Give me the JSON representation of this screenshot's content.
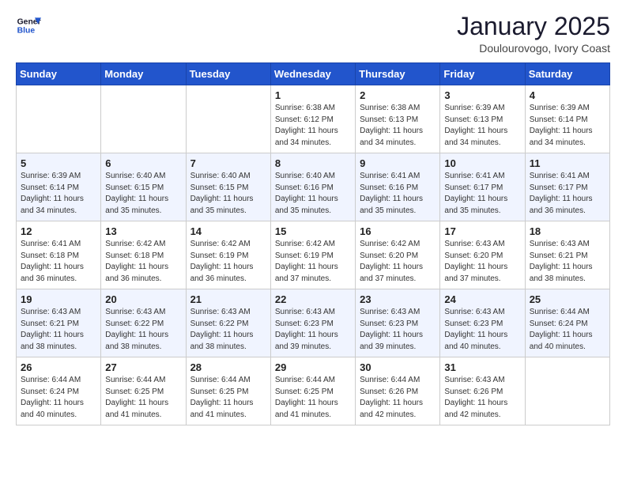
{
  "logo": {
    "line1": "General",
    "line2": "Blue"
  },
  "title": "January 2025",
  "location": "Doulourovogo, Ivory Coast",
  "weekdays": [
    "Sunday",
    "Monday",
    "Tuesday",
    "Wednesday",
    "Thursday",
    "Friday",
    "Saturday"
  ],
  "weeks": [
    [
      {
        "day": "",
        "info": ""
      },
      {
        "day": "",
        "info": ""
      },
      {
        "day": "",
        "info": ""
      },
      {
        "day": "1",
        "info": "Sunrise: 6:38 AM\nSunset: 6:12 PM\nDaylight: 11 hours\nand 34 minutes."
      },
      {
        "day": "2",
        "info": "Sunrise: 6:38 AM\nSunset: 6:13 PM\nDaylight: 11 hours\nand 34 minutes."
      },
      {
        "day": "3",
        "info": "Sunrise: 6:39 AM\nSunset: 6:13 PM\nDaylight: 11 hours\nand 34 minutes."
      },
      {
        "day": "4",
        "info": "Sunrise: 6:39 AM\nSunset: 6:14 PM\nDaylight: 11 hours\nand 34 minutes."
      }
    ],
    [
      {
        "day": "5",
        "info": "Sunrise: 6:39 AM\nSunset: 6:14 PM\nDaylight: 11 hours\nand 34 minutes."
      },
      {
        "day": "6",
        "info": "Sunrise: 6:40 AM\nSunset: 6:15 PM\nDaylight: 11 hours\nand 35 minutes."
      },
      {
        "day": "7",
        "info": "Sunrise: 6:40 AM\nSunset: 6:15 PM\nDaylight: 11 hours\nand 35 minutes."
      },
      {
        "day": "8",
        "info": "Sunrise: 6:40 AM\nSunset: 6:16 PM\nDaylight: 11 hours\nand 35 minutes."
      },
      {
        "day": "9",
        "info": "Sunrise: 6:41 AM\nSunset: 6:16 PM\nDaylight: 11 hours\nand 35 minutes."
      },
      {
        "day": "10",
        "info": "Sunrise: 6:41 AM\nSunset: 6:17 PM\nDaylight: 11 hours\nand 35 minutes."
      },
      {
        "day": "11",
        "info": "Sunrise: 6:41 AM\nSunset: 6:17 PM\nDaylight: 11 hours\nand 36 minutes."
      }
    ],
    [
      {
        "day": "12",
        "info": "Sunrise: 6:41 AM\nSunset: 6:18 PM\nDaylight: 11 hours\nand 36 minutes."
      },
      {
        "day": "13",
        "info": "Sunrise: 6:42 AM\nSunset: 6:18 PM\nDaylight: 11 hours\nand 36 minutes."
      },
      {
        "day": "14",
        "info": "Sunrise: 6:42 AM\nSunset: 6:19 PM\nDaylight: 11 hours\nand 36 minutes."
      },
      {
        "day": "15",
        "info": "Sunrise: 6:42 AM\nSunset: 6:19 PM\nDaylight: 11 hours\nand 37 minutes."
      },
      {
        "day": "16",
        "info": "Sunrise: 6:42 AM\nSunset: 6:20 PM\nDaylight: 11 hours\nand 37 minutes."
      },
      {
        "day": "17",
        "info": "Sunrise: 6:43 AM\nSunset: 6:20 PM\nDaylight: 11 hours\nand 37 minutes."
      },
      {
        "day": "18",
        "info": "Sunrise: 6:43 AM\nSunset: 6:21 PM\nDaylight: 11 hours\nand 38 minutes."
      }
    ],
    [
      {
        "day": "19",
        "info": "Sunrise: 6:43 AM\nSunset: 6:21 PM\nDaylight: 11 hours\nand 38 minutes."
      },
      {
        "day": "20",
        "info": "Sunrise: 6:43 AM\nSunset: 6:22 PM\nDaylight: 11 hours\nand 38 minutes."
      },
      {
        "day": "21",
        "info": "Sunrise: 6:43 AM\nSunset: 6:22 PM\nDaylight: 11 hours\nand 38 minutes."
      },
      {
        "day": "22",
        "info": "Sunrise: 6:43 AM\nSunset: 6:23 PM\nDaylight: 11 hours\nand 39 minutes."
      },
      {
        "day": "23",
        "info": "Sunrise: 6:43 AM\nSunset: 6:23 PM\nDaylight: 11 hours\nand 39 minutes."
      },
      {
        "day": "24",
        "info": "Sunrise: 6:43 AM\nSunset: 6:23 PM\nDaylight: 11 hours\nand 40 minutes."
      },
      {
        "day": "25",
        "info": "Sunrise: 6:44 AM\nSunset: 6:24 PM\nDaylight: 11 hours\nand 40 minutes."
      }
    ],
    [
      {
        "day": "26",
        "info": "Sunrise: 6:44 AM\nSunset: 6:24 PM\nDaylight: 11 hours\nand 40 minutes."
      },
      {
        "day": "27",
        "info": "Sunrise: 6:44 AM\nSunset: 6:25 PM\nDaylight: 11 hours\nand 41 minutes."
      },
      {
        "day": "28",
        "info": "Sunrise: 6:44 AM\nSunset: 6:25 PM\nDaylight: 11 hours\nand 41 minutes."
      },
      {
        "day": "29",
        "info": "Sunrise: 6:44 AM\nSunset: 6:25 PM\nDaylight: 11 hours\nand 41 minutes."
      },
      {
        "day": "30",
        "info": "Sunrise: 6:44 AM\nSunset: 6:26 PM\nDaylight: 11 hours\nand 42 minutes."
      },
      {
        "day": "31",
        "info": "Sunrise: 6:43 AM\nSunset: 6:26 PM\nDaylight: 11 hours\nand 42 minutes."
      },
      {
        "day": "",
        "info": ""
      }
    ]
  ]
}
